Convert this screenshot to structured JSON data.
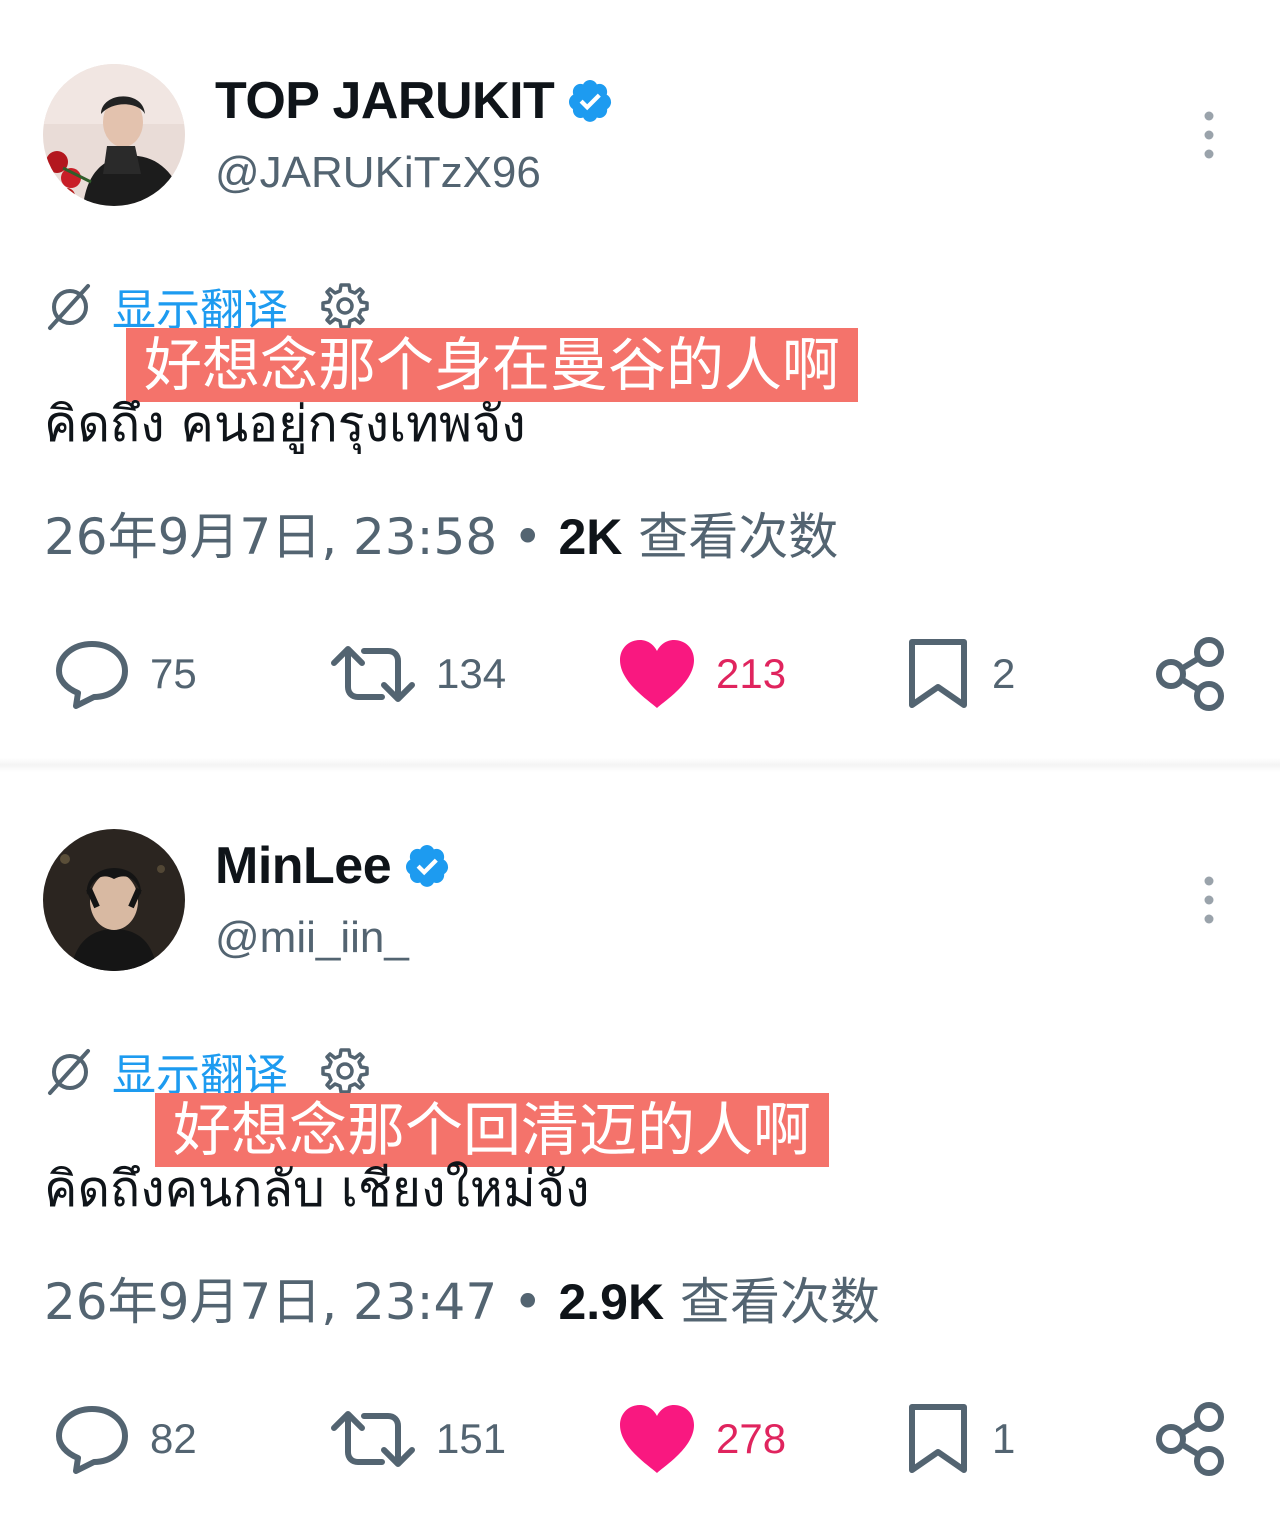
{
  "tweets": [
    {
      "display_name": "TOP JARUKIT",
      "handle": "@JARUKiTzX96",
      "translate_label": "显示翻译",
      "subtitle": "好想念那个身在曼谷的人啊",
      "text": "คิดถึง คนอยู่กรุงเทพจัง",
      "date": "26年9月7日, 23:58",
      "separator": "•",
      "views": "2K",
      "views_label": "查看次数",
      "replies": "75",
      "retweets": "134",
      "likes": "213",
      "bookmarks": "2"
    },
    {
      "display_name": "MinLee",
      "handle": "@mii_iin_",
      "translate_label": "显示翻译",
      "subtitle": "好想念那个回清迈的人啊",
      "text": "คิดถึงคนกลับ เชียงใหม่จัง",
      "date": "26年9月7日, 23:47",
      "separator": "•",
      "views": "2.9K",
      "views_label": "查看次数",
      "replies": "82",
      "retweets": "151",
      "likes": "278",
      "bookmarks": "1"
    }
  ],
  "icons": {
    "verified": "verified-badge-icon",
    "more": "more-vertical-icon",
    "translate": "globe-slash-icon",
    "settings": "gear-icon",
    "reply": "reply-bubble-icon",
    "retweet": "retweet-icon",
    "like": "heart-icon",
    "bookmark": "bookmark-icon",
    "share": "share-icon"
  },
  "colors": {
    "accent": "#1d9bf0",
    "like": "#f91880",
    "like_count": "#e0245e",
    "subtitle_bg": "#f4736b",
    "secondary_text": "#536471"
  }
}
